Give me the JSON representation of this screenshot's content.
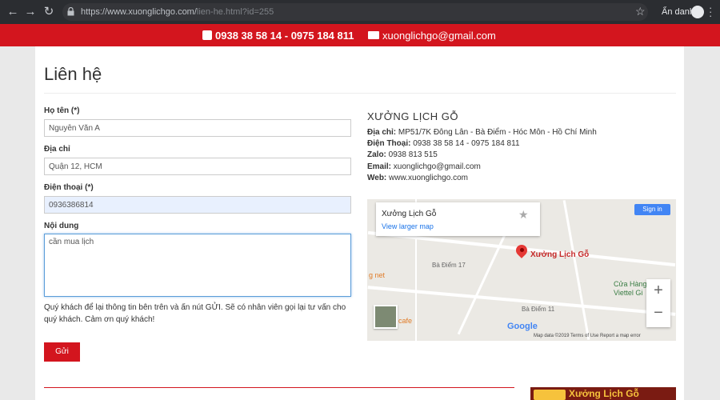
{
  "browser": {
    "url_main": "https://www.xuonglichgo.com/",
    "url_rest": "lien-he.html?id=255",
    "incognito_label": "Ẩn danh"
  },
  "topbar": {
    "phone": "0938 38 58 14 - 0975 184 811",
    "email": "xuonglichgo@gmail.com"
  },
  "page": {
    "title": "Liên hệ"
  },
  "form": {
    "name_label": "Họ tên (*)",
    "name_value": "Nguyễn Văn A",
    "address_label": "Địa chỉ",
    "address_value": "Quận 12, HCM",
    "phone_label": "Điện thoại (*)",
    "phone_value": "0936386814",
    "content_label": "Nội dung",
    "content_value": "cần mua lịch",
    "help_text": "Quý khách để lại thông tin bên trên và ấn nút GỬI. Sẽ có nhân viên gọi lại tư vấn cho quý khách. Cảm ơn quý khách!",
    "submit_label": "Gửi"
  },
  "company": {
    "name": "XƯỞNG LỊCH GỖ",
    "address_label": "Địa chỉ:",
    "address": "MP51/7K Đông Lân - Bà Điểm - Hóc Môn - Hồ Chí Minh",
    "phone_label": "Điện Thoại:",
    "phone": "0938 38 58 14 - 0975 184 811",
    "zalo_label": "Zalo:",
    "zalo": "0938 813 515",
    "email_label": "Email:",
    "email": "xuonglichgo@gmail.com",
    "web_label": "Web:",
    "web": "www.xuonglichgo.com"
  },
  "map": {
    "place_name": "Xưởng Lịch Gỗ",
    "view_larger": "View larger map",
    "sign_in": "Sign in",
    "pin_label": "Xưởng Lịch Gỗ",
    "street_1": "Bà Điểm 17",
    "street_2": "Bà Điểm 11",
    "poi_1": "Cửa Hàng",
    "poi_2": "Viettel Gi",
    "poi_3": "g net",
    "poi_4": "cafe",
    "google": "Google",
    "footer": "Map data ©2019   Terms of Use   Report a map error"
  },
  "banner": {
    "text": "Xưởng Lịch Gỗ"
  }
}
